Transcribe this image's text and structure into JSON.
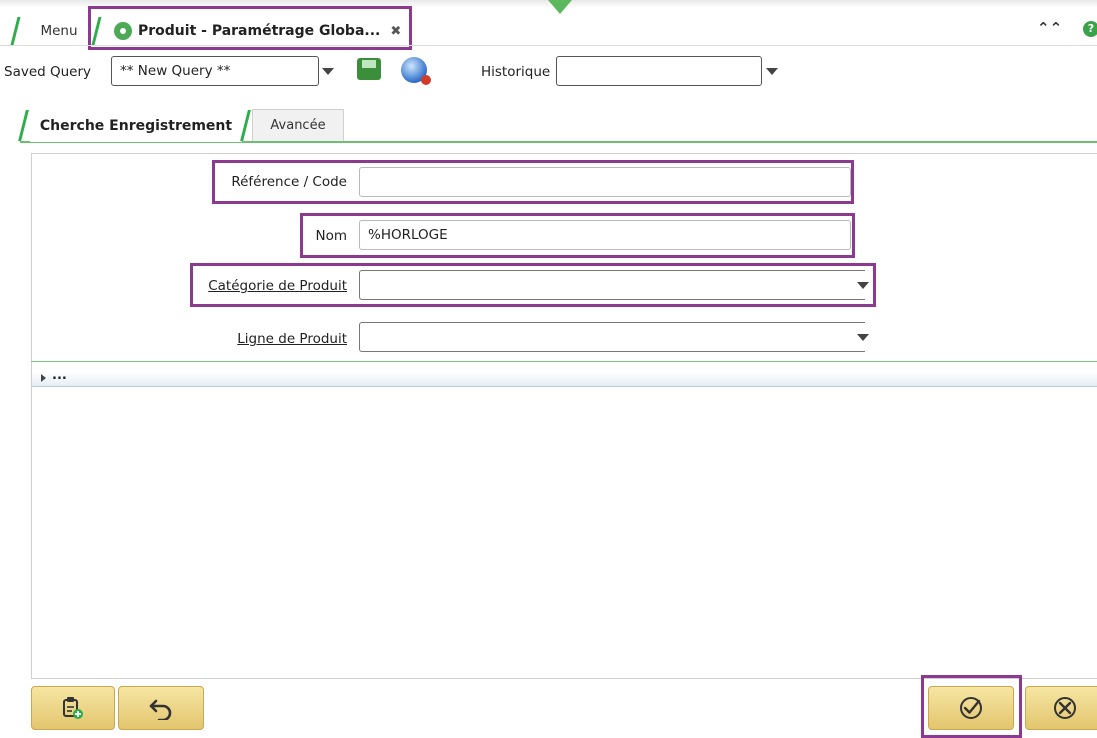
{
  "tabs": {
    "menu_label": "Menu",
    "active_label": "Produit - Paramétrage Globa...",
    "close_glyph": "✖"
  },
  "top_right": {
    "collapse_glyph": "⌃⌃",
    "help_glyph": "?"
  },
  "query": {
    "saved_query_label": "Saved Query",
    "saved_query_value": "** New Query **",
    "historique_label": "Historique",
    "historique_value": ""
  },
  "section_tabs": {
    "search": "Cherche Enregistrement",
    "advanced": "Avancée"
  },
  "form": {
    "reference_label": "Référence / Code",
    "reference_value": "",
    "nom_label": "Nom",
    "nom_value": "%HORLOGE",
    "categorie_label": "Catégorie de Produit",
    "categorie_value": "",
    "ligne_label": "Ligne de Produit",
    "ligne_value": ""
  },
  "expander": {
    "label": "..."
  },
  "icons": {
    "active_tab": "gear-icon",
    "save": "save-icon",
    "globe": "globe-icon",
    "new_record": "new-record-icon",
    "undo": "undo-icon",
    "ok": "check-circle-icon",
    "cancel": "cancel-circle-icon"
  },
  "colors": {
    "accent_green": "#2eae4a",
    "highlight_purple": "#8b3a8f",
    "button_gold": "#e8cc7a"
  }
}
